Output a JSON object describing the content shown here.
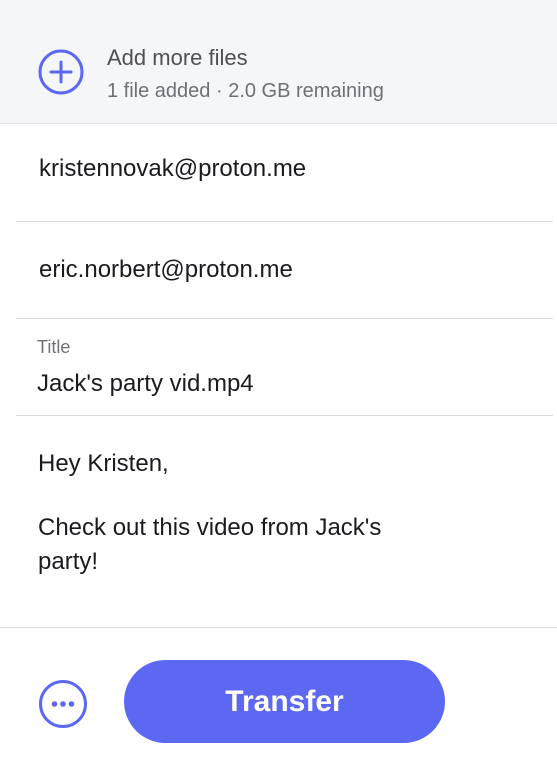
{
  "add_files": {
    "title": "Add more files",
    "subtitle": "1 file added · 2.0 GB remaining",
    "icon": "plus-circle-icon"
  },
  "recipients": [
    "kristennovak@proton.me",
    "eric.norbert@proton.me"
  ],
  "title_field": {
    "label": "Title",
    "value": "Jack's party vid.mp4"
  },
  "message": {
    "line1": "Hey Kristen,",
    "line2": "Check out this video from Jack's",
    "line3": "party!"
  },
  "footer": {
    "more_icon": "more-options-icon",
    "transfer_label": "Transfer"
  },
  "colors": {
    "accent": "#5c68f2",
    "header_bg": "#f5f6f8",
    "text_primary": "#1b1b1f",
    "text_secondary": "#6f7076"
  }
}
